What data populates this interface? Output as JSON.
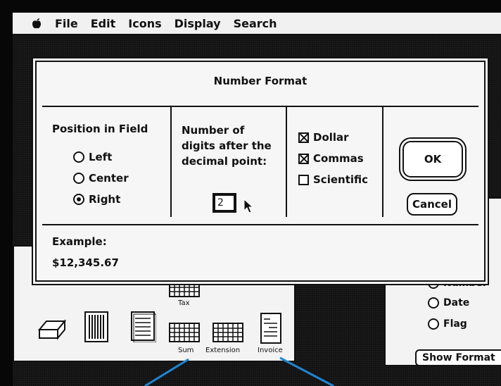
{
  "menubar": {
    "items": [
      "File",
      "Edit",
      "Icons",
      "Display",
      "Search"
    ]
  },
  "dialog": {
    "title": "Number Format",
    "position": {
      "heading": "Position in Field",
      "options": [
        {
          "label": "Left",
          "selected": false
        },
        {
          "label": "Center",
          "selected": false
        },
        {
          "label": "Right",
          "selected": true
        }
      ]
    },
    "digits": {
      "heading_lines": [
        "Number of",
        "digits after the",
        "decimal point:"
      ],
      "value": "2"
    },
    "formats": [
      {
        "label": "Dollar",
        "checked": true
      },
      {
        "label": "Commas",
        "checked": true
      },
      {
        "label": "Scientific",
        "checked": false
      }
    ],
    "ok_label": "OK",
    "cancel_label": "Cancel",
    "example_label": "Example:",
    "example_value": "$12,345.67"
  },
  "left_window": {
    "icons": [
      {
        "label": "Tax"
      },
      {
        "label": "Sum"
      },
      {
        "label": "Extension"
      },
      {
        "label": "Invoice"
      }
    ]
  },
  "right_window": {
    "types": [
      {
        "label": "Number",
        "selected": true
      },
      {
        "label": "Date",
        "selected": false
      },
      {
        "label": "Flag",
        "selected": false
      }
    ],
    "show_format_label": "Show Format"
  },
  "colors": {
    "pointer_line": "#1e86d4",
    "screen": "#141414",
    "window": "#f3f3f3"
  }
}
